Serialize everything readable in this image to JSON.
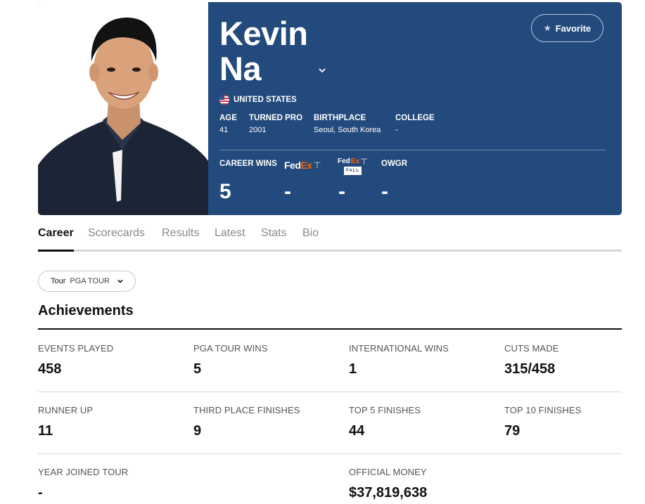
{
  "player": {
    "first_name": "Kevin",
    "last_name": "Na",
    "country": "UNITED STATES",
    "favorite_label": "Favorite"
  },
  "bio": [
    {
      "label": "AGE",
      "value": "41"
    },
    {
      "label": "TURNED PRO",
      "value": "2001"
    },
    {
      "label": "BIRTHPLACE",
      "value": "Seoul, South Korea"
    },
    {
      "label": "COLLEGE",
      "value": "-"
    }
  ],
  "career_stats": {
    "career_wins_label": "CAREER WINS",
    "career_wins": "5",
    "fedex_logo_a": "Fed",
    "fedex_logo_b": "Ex",
    "fedex_value": "-",
    "fedex_fall_word": "FALL",
    "fedex_fall_value": "-",
    "owgr_label": "OWGR",
    "owgr_value": "-"
  },
  "tabs": [
    "Career",
    "Scorecards",
    "Results",
    "Latest",
    "Stats",
    "Bio"
  ],
  "active_tab": "Career",
  "tour_filter": {
    "label": "Tour",
    "value": "PGA TOUR"
  },
  "achievements": {
    "title": "Achievements",
    "items": [
      {
        "label": "EVENTS PLAYED",
        "value": "458"
      },
      {
        "label": "PGA TOUR WINS",
        "value": "5"
      },
      {
        "label": "INTERNATIONAL WINS",
        "value": "1"
      },
      {
        "label": "CUTS MADE",
        "value": "315/458"
      },
      {
        "label": "RUNNER UP",
        "value": "11"
      },
      {
        "label": "THIRD PLACE FINISHES",
        "value": "9"
      },
      {
        "label": "TOP 5 FINISHES",
        "value": "44"
      },
      {
        "label": "TOP 10 FINISHES",
        "value": "79"
      },
      {
        "label": "YEAR JOINED TOUR",
        "value": "-"
      },
      {
        "label": "OFFICIAL MONEY",
        "value": "$37,819,638"
      }
    ]
  },
  "colors": {
    "hero_bg": "#234a7c",
    "fedex_orange": "#ff6200"
  }
}
